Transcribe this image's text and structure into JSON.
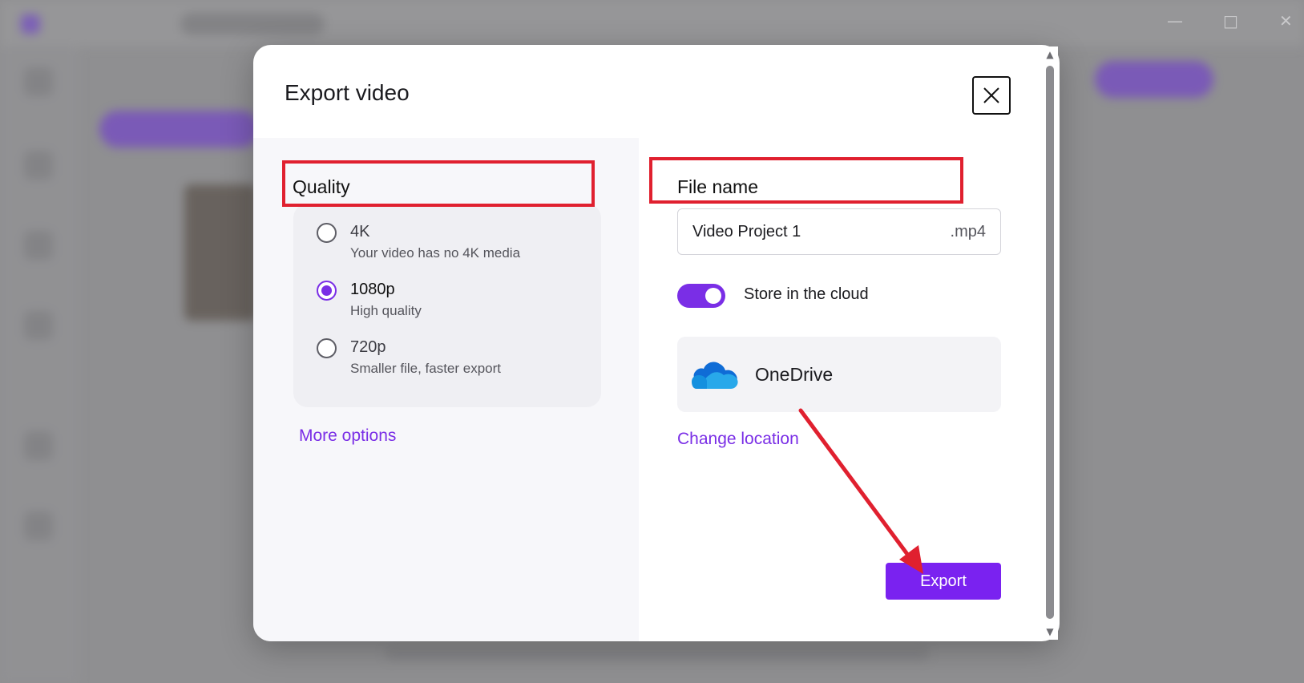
{
  "dialog": {
    "title": "Export video",
    "close_icon": "close-icon"
  },
  "quality": {
    "heading": "Quality",
    "options": [
      {
        "title": "4K",
        "subtitle": "Your video has no 4K media",
        "selected": false
      },
      {
        "title": "1080p",
        "subtitle": "High quality",
        "selected": true
      },
      {
        "title": "720p",
        "subtitle": "Smaller file, faster export",
        "selected": false
      }
    ],
    "more_options": "More options"
  },
  "file": {
    "heading": "File name",
    "name_value": "Video Project 1",
    "extension": ".mp4",
    "store_in_cloud_label": "Store in the cloud",
    "store_in_cloud_on": true,
    "location_name": "OneDrive",
    "location_icon": "onedrive-cloud-icon",
    "change_location": "Change location",
    "export_label": "Export"
  },
  "colors": {
    "accent": "#7a2ee6",
    "export_button": "#7a22f0",
    "highlight": "#e0202f"
  }
}
